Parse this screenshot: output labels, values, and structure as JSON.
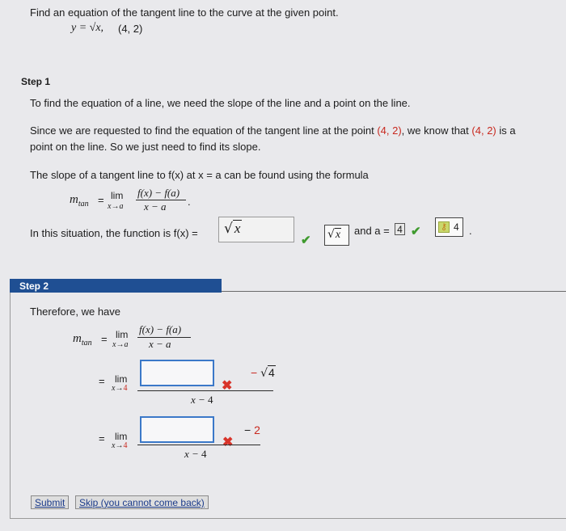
{
  "problem": {
    "instruction": "Find an equation of the tangent line to the curve at the given point.",
    "equation": "y = √x,",
    "point": "(4, 2)"
  },
  "step1": {
    "label": "Step 1",
    "para1": "To find the equation of a line, we need the slope of the line and a point on the line.",
    "para2_line1_a": "Since we are requested to find the equation of the tangent line at the point",
    "para2_point": "(4, 2)",
    "para2_line1_b": ", we know that",
    "para2_point2": "(4, 2)",
    "para2_line1_c": "is a",
    "para2_line2": "point on the line. So we just need to find its slope.",
    "para3": "The slope of a tangent line to f(x) at x = a can be found using the formula",
    "mtan": "m",
    "mtan_sub": "tan",
    "eq": "=",
    "lim": "lim",
    "lim_sub": "x→a",
    "numerator": "f(x) − f(a)",
    "denominator": "x − a",
    "situation_text": "In this situation, the function is f(x) =",
    "f_input_value": "√x",
    "f_feedback": "√x",
    "and_a": "and a =",
    "a_input_value": "4",
    "a_feedback": "4",
    "period": "."
  },
  "step2": {
    "label": "Step 2",
    "therefore": "Therefore, we have",
    "mtan": "m",
    "mtan_sub": "tan",
    "eq": "=",
    "lim": "lim",
    "lim_sub_a": "x→a",
    "lim_sub_4": "x→4",
    "numerator": "f(x) − f(a)",
    "denominator": "x − a",
    "row2_right": "− √4",
    "row2_den": "x − 4",
    "row3_right": "− 2",
    "row3_den": "x − 4"
  },
  "buttons": {
    "submit": "Submit",
    "skip": "Skip (you cannot come back)"
  },
  "colors": {
    "accent": "#1f4f93",
    "correct": "#3f9a2e",
    "incorrect": "#d8342a",
    "point_red": "#c8281e"
  }
}
